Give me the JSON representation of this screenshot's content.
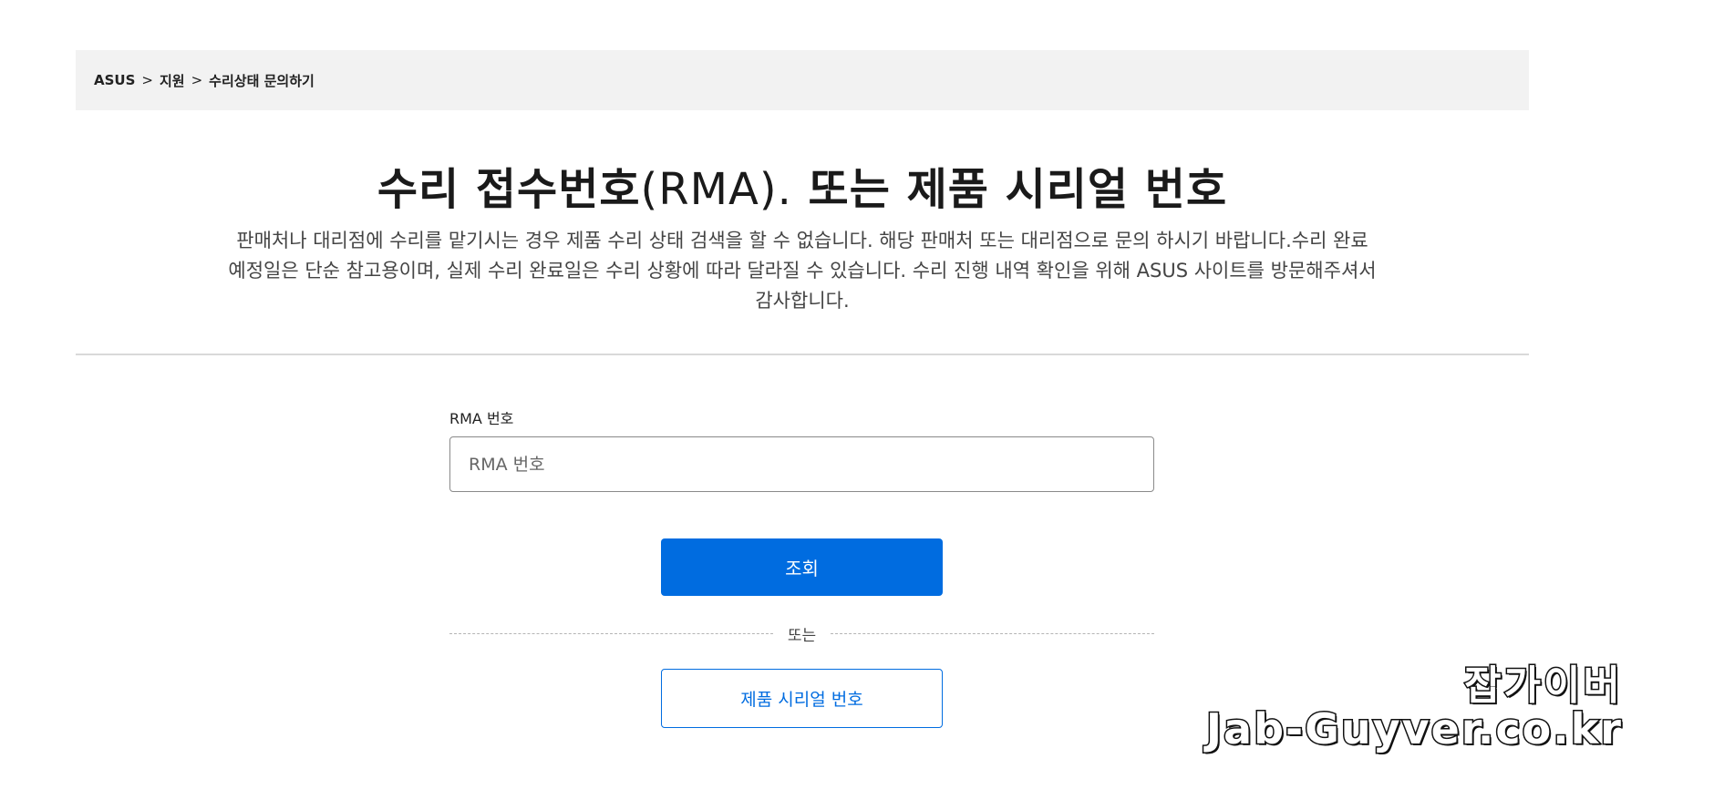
{
  "breadcrumb": {
    "items": [
      "ASUS",
      "지원",
      "수리상태 문의하기"
    ],
    "separator": ">"
  },
  "header": {
    "title_prefix": "수리 접수번호",
    "title_rma": "(RMA).",
    "title_suffix": " 또는 제품 시리얼 번호",
    "description_line1": "판매처나 대리점에 수리를 맡기시는 경우 제품 수리 상태 검색을 할 수 없습니다. 해당 판매처 또는 대리점으로 문의 하시기 바랍니다.수리 완료",
    "description_line2": "예정일은 단순 참고용이며, 실제 수리 완료일은 수리 상황에 따라 달라질 수 있습니다. 수리 진행 내역 확인을 위해 ASUS 사이트를 방문해주셔서",
    "description_line3": "감사합니다."
  },
  "form": {
    "rma_label": "RMA 번호",
    "rma_placeholder": "RMA 번호",
    "rma_value": "",
    "search_button": "조회",
    "or_text": "또는",
    "serial_button": "제품 시리얼 번호"
  },
  "watermark": {
    "name": "잡가이버",
    "url": "Jab-Guyver.co.kr"
  },
  "colors": {
    "primary": "#006ce0",
    "breadcrumb_bg": "#f2f2f2",
    "divider": "#d9d9d9"
  }
}
